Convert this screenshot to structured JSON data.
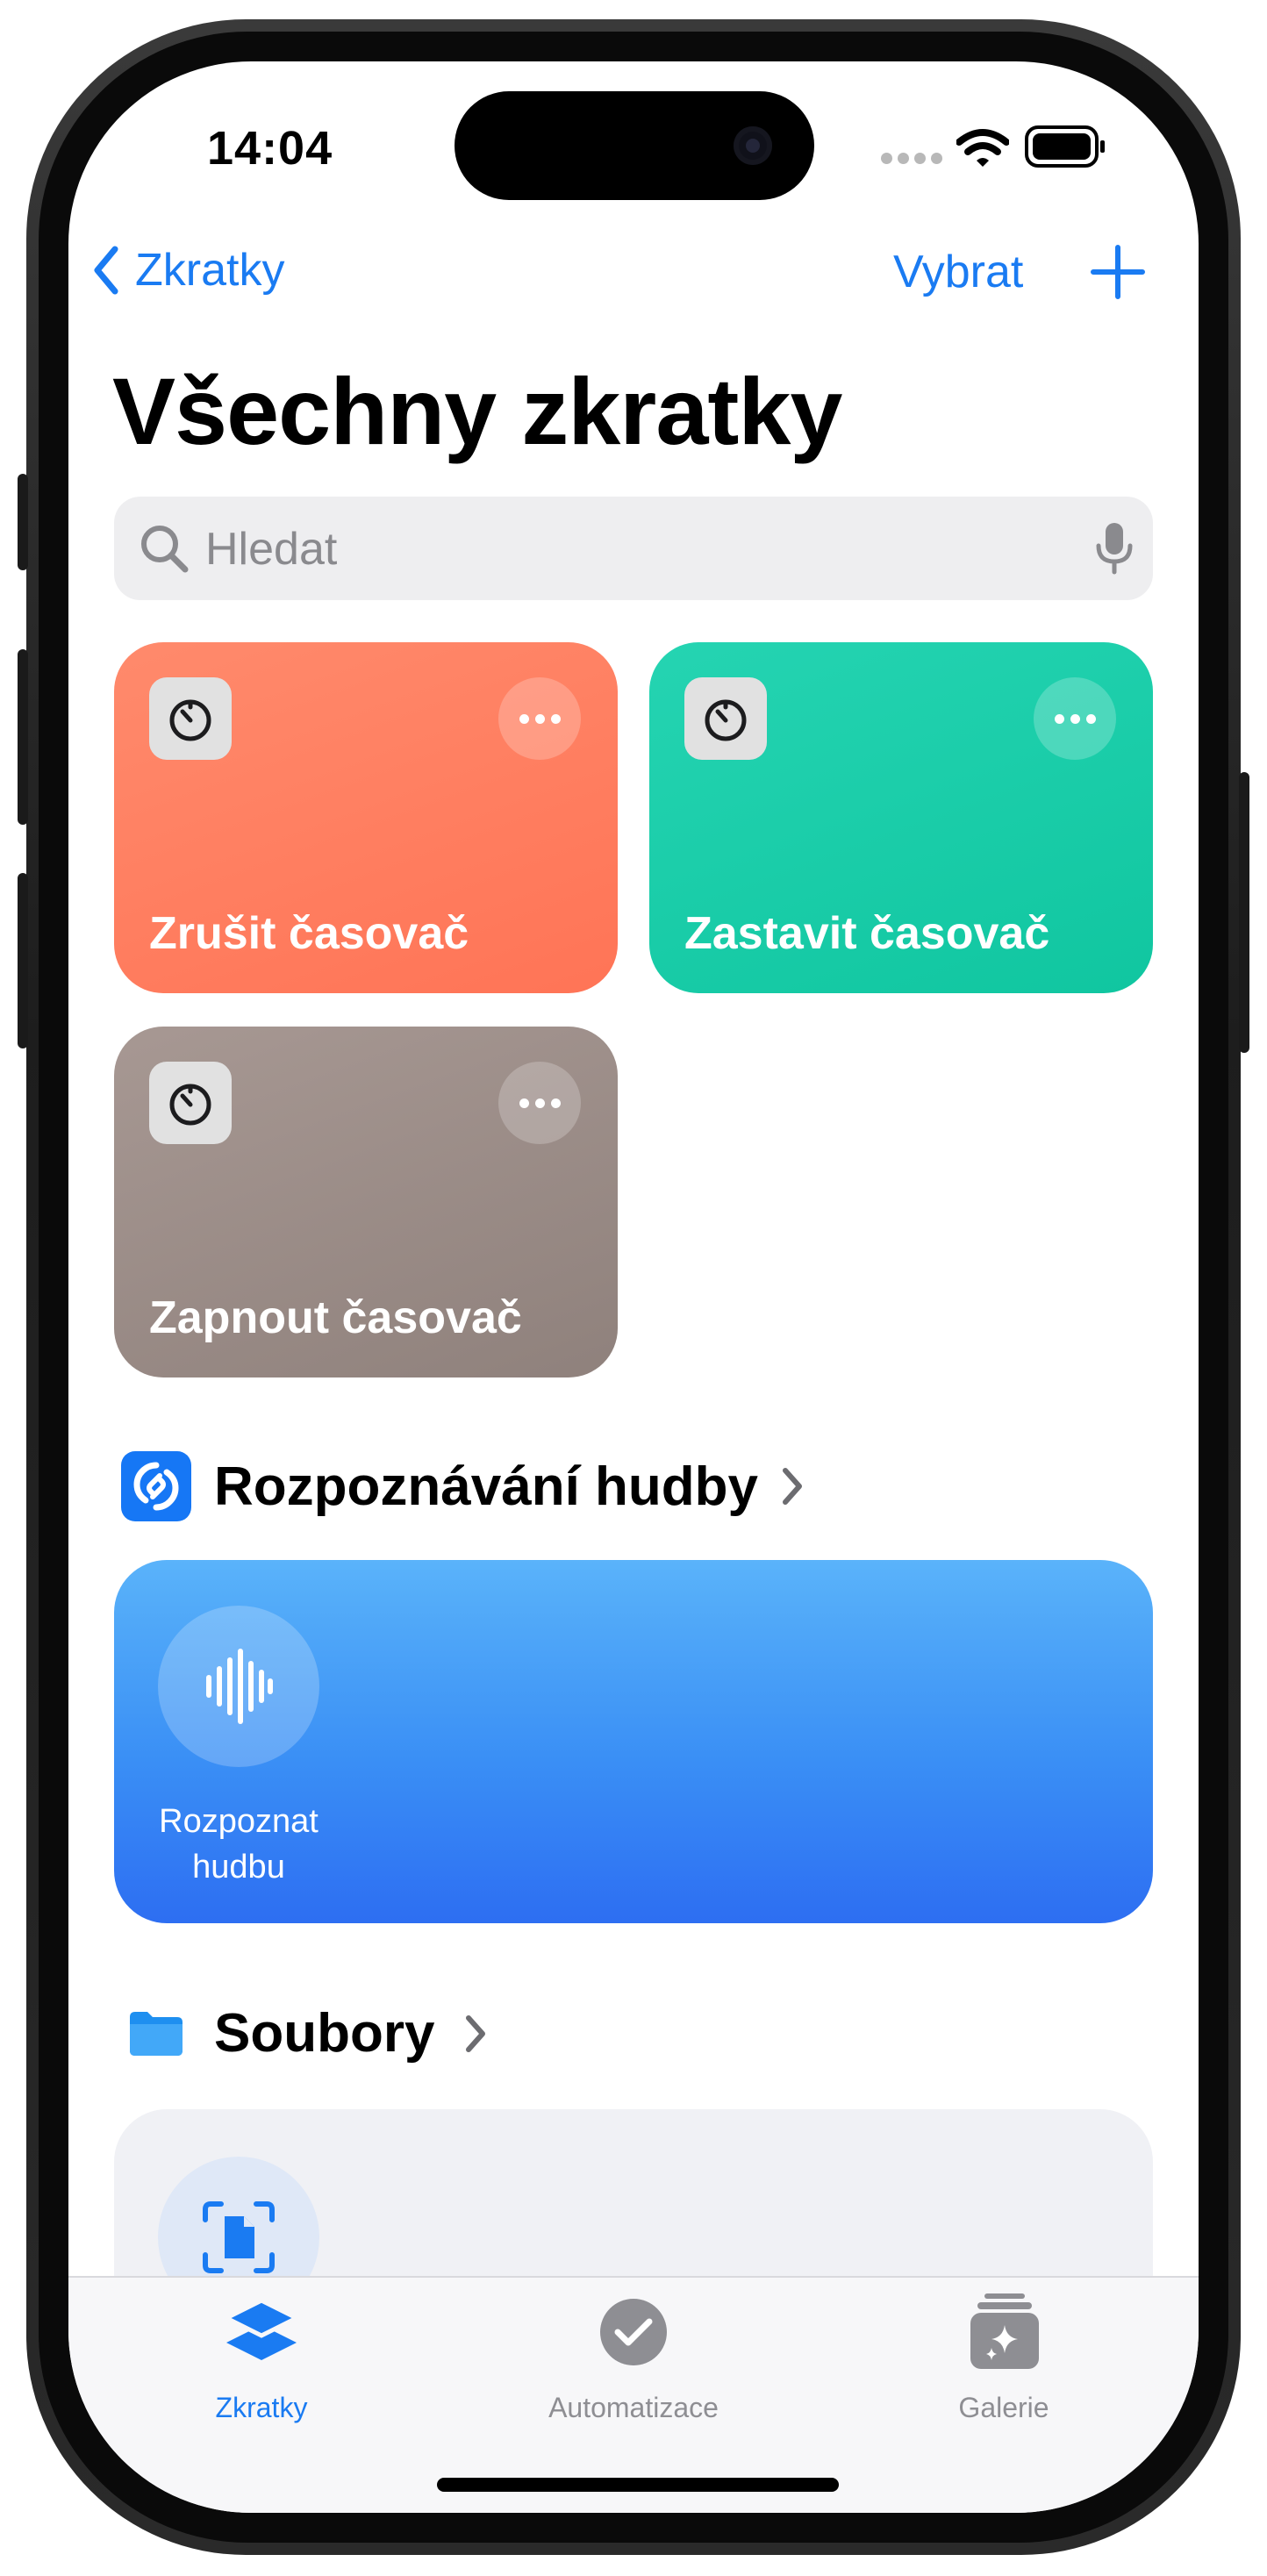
{
  "status_bar": {
    "time": "14:04"
  },
  "nav": {
    "back_label": "Zkratky",
    "select_label": "Vybrat"
  },
  "page_title": "Všechny zkratky",
  "search": {
    "placeholder": "Hledat",
    "value": ""
  },
  "shortcuts": [
    {
      "label": "Zrušit časovač",
      "color": "#ff7f60",
      "icon": "timer-icon"
    },
    {
      "label": "Zastavit časovač",
      "color": "#1fcca8",
      "icon": "timer-icon"
    },
    {
      "label": "Zapnout časovač",
      "color": "#9b8c87",
      "icon": "timer-icon"
    }
  ],
  "sections": {
    "music": {
      "title": "Rozpoznávání hudby",
      "icon": "shazam-icon",
      "card_label_line1": "Rozpoznat",
      "card_label_line2": "hudbu",
      "card_color": "#3a8ff5"
    },
    "files": {
      "title": "Soubory",
      "icon": "folder-icon",
      "card_icon": "document-scan-icon"
    }
  },
  "tabbar": {
    "items": [
      {
        "label": "Zkratky",
        "icon": "layers-icon",
        "active": true
      },
      {
        "label": "Automatizace",
        "icon": "checkmark-clock-icon",
        "active": false
      },
      {
        "label": "Galerie",
        "icon": "gallery-sparkle-icon",
        "active": false
      }
    ]
  },
  "colors": {
    "accent": "#1a7bf2",
    "inactive_tab": "#8e8e93"
  }
}
